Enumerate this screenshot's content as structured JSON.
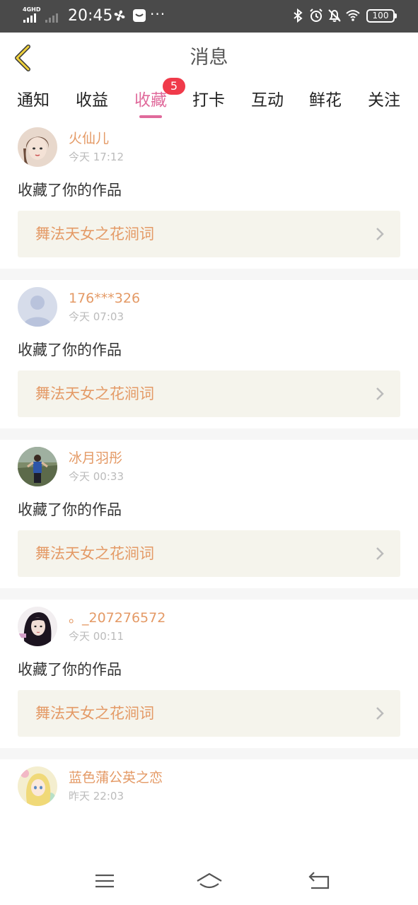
{
  "status_bar": {
    "network": "4GHD",
    "time": "20:45",
    "more": "···",
    "battery": "100"
  },
  "header": {
    "title": "消息"
  },
  "tabs": [
    {
      "label": "通知",
      "active": false
    },
    {
      "label": "收益",
      "active": false
    },
    {
      "label": "收藏",
      "active": true,
      "badge": "5"
    },
    {
      "label": "打卡",
      "active": false
    },
    {
      "label": "互动",
      "active": false
    },
    {
      "label": "鲜花",
      "active": false
    },
    {
      "label": "关注",
      "active": false
    }
  ],
  "items": [
    {
      "user": "火仙儿",
      "time": "今天 17:12",
      "action": "收藏了你的作品",
      "work": "舞法天女之花涧词"
    },
    {
      "user": "176***326",
      "time": "今天 07:03",
      "action": "收藏了你的作品",
      "work": "舞法天女之花涧词"
    },
    {
      "user": "冰月羽彤",
      "time": "今天 00:33",
      "action": "收藏了你的作品",
      "work": "舞法天女之花涧词"
    },
    {
      "user": "。_207276572",
      "time": "今天 00:11",
      "action": "收藏了你的作品",
      "work": "舞法天女之花涧词"
    },
    {
      "user": "蓝色蒲公英之恋",
      "time": "昨天 22:03"
    }
  ],
  "colors": {
    "accent_pink": "#e06a9b",
    "name_orange": "#e49a66",
    "badge_red": "#f03a4a",
    "card_bg": "#f5f4ec"
  }
}
